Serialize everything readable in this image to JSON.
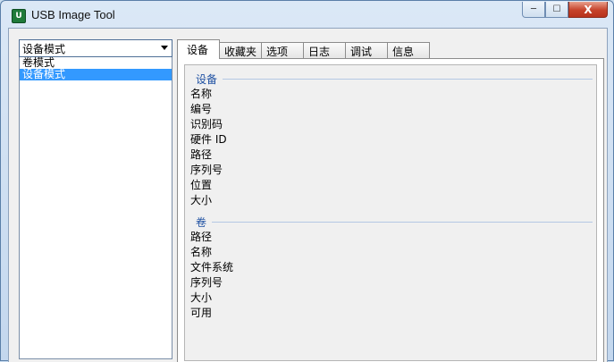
{
  "window": {
    "title": "USB Image Tool",
    "app_icon": "U",
    "controls": {
      "minimize": "─",
      "maximize": "☐",
      "close": "X"
    }
  },
  "mode_selector": {
    "selected": "设备模式",
    "options": [
      "卷模式",
      "设备模式"
    ]
  },
  "tabs": [
    "设备",
    "收藏夹",
    "选项",
    "日志",
    "调试",
    "信息"
  ],
  "device_group": {
    "title": "设备",
    "fields": [
      "名称",
      "编号",
      "识别码",
      "硬件 ID",
      "路径",
      "序列号",
      "位置",
      "大小"
    ]
  },
  "volume_group": {
    "title": "卷",
    "fields": [
      "路径",
      "名称",
      "文件系统",
      "序列号",
      "大小",
      "可用"
    ]
  },
  "colors": {
    "selection": "#3399ff",
    "group_title": "#1e50a2",
    "close_button": "#c6422a"
  }
}
